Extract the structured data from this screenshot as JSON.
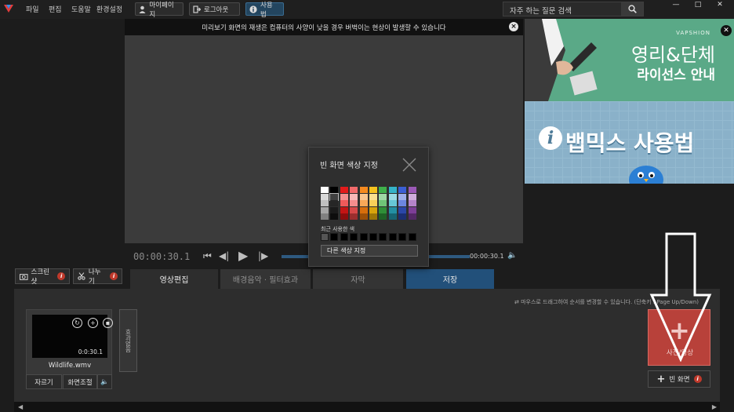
{
  "menu": [
    "파일",
    "편집",
    "도움말",
    "환경설정"
  ],
  "top_buttons": {
    "mypage": "마이페이지",
    "logout": "로그아웃",
    "howto": "사용법"
  },
  "search": {
    "placeholder": "자주 하는 질문 검색"
  },
  "window_controls": {
    "minimize": "—",
    "maximize": "□",
    "close": "✕"
  },
  "preview": {
    "notice": "미리보기 화면의 재생은 컴퓨터의 사양이 낮을 경우 버벅이는 현상이 발생할 수 있습니다"
  },
  "ad": {
    "brand": "VAPSHION",
    "title1": "영리&단체",
    "title2": "라이선스 안내",
    "howto": "뱁믹스 사용법"
  },
  "player": {
    "current_time": "00:00:30.1",
    "end_time": "00:00:30.1"
  },
  "toolbar": {
    "screenshot": "스크린샷",
    "split": "나누기"
  },
  "tabs": [
    "영상편집",
    "배경음악 · 필터효과",
    "자막",
    "저장"
  ],
  "timeline": {
    "hint": "마우스로 드래그하여 순서를 변경할 수 있습니다. (단축키 : Page Up/Down)",
    "clip": {
      "name": "Wildlife.wmv",
      "duration": "0:0:30.1",
      "trim": "자르기",
      "adjust": "화면조절"
    },
    "effect_strip": "효과없음",
    "add_video": "사진/영상",
    "blank_screen": "빈 화면"
  },
  "color_dialog": {
    "title": "빈 화면 색상 지정",
    "recent_label": "최근 사용한 색",
    "more_button": "다른 색상 지정",
    "columns": [
      [
        "#ffffff",
        "#d9d9d9",
        "#bfbfbf",
        "#a6a6a6",
        "#808080"
      ],
      [
        "#000000",
        "#404040",
        "#262626",
        "#1a1a1a",
        "#0d0d0d"
      ],
      [
        "#e31b1b",
        "#f58f8f",
        "#ee5a5a",
        "#c41414",
        "#8c0d0d"
      ],
      [
        "#f26b6b",
        "#f9b8b8",
        "#f58d8d",
        "#d64848",
        "#9a2e2e"
      ],
      [
        "#f58a1f",
        "#fbc58e",
        "#f8a858",
        "#d86e0c",
        "#9c4f08"
      ],
      [
        "#f5c21f",
        "#fbe08e",
        "#f8d058",
        "#d8a40c",
        "#9c7608"
      ],
      [
        "#3fb04a",
        "#9fd8a4",
        "#6fc477",
        "#2f8f38",
        "#1f6226"
      ],
      [
        "#35b3c8",
        "#9adbe5",
        "#66c7d6",
        "#2390a3",
        "#176573"
      ],
      [
        "#3b5fd4",
        "#9daeea",
        "#6c86df",
        "#2b47a8",
        "#1c2f73"
      ],
      [
        "#9b59b6",
        "#cfacdb",
        "#b583c9",
        "#7d3e96",
        "#542966"
      ]
    ],
    "recent_colors": [
      "#555555",
      "#000000",
      "#000000",
      "#000000",
      "#000000",
      "#000000",
      "#000000",
      "#000000",
      "#000000",
      "#000000"
    ]
  }
}
